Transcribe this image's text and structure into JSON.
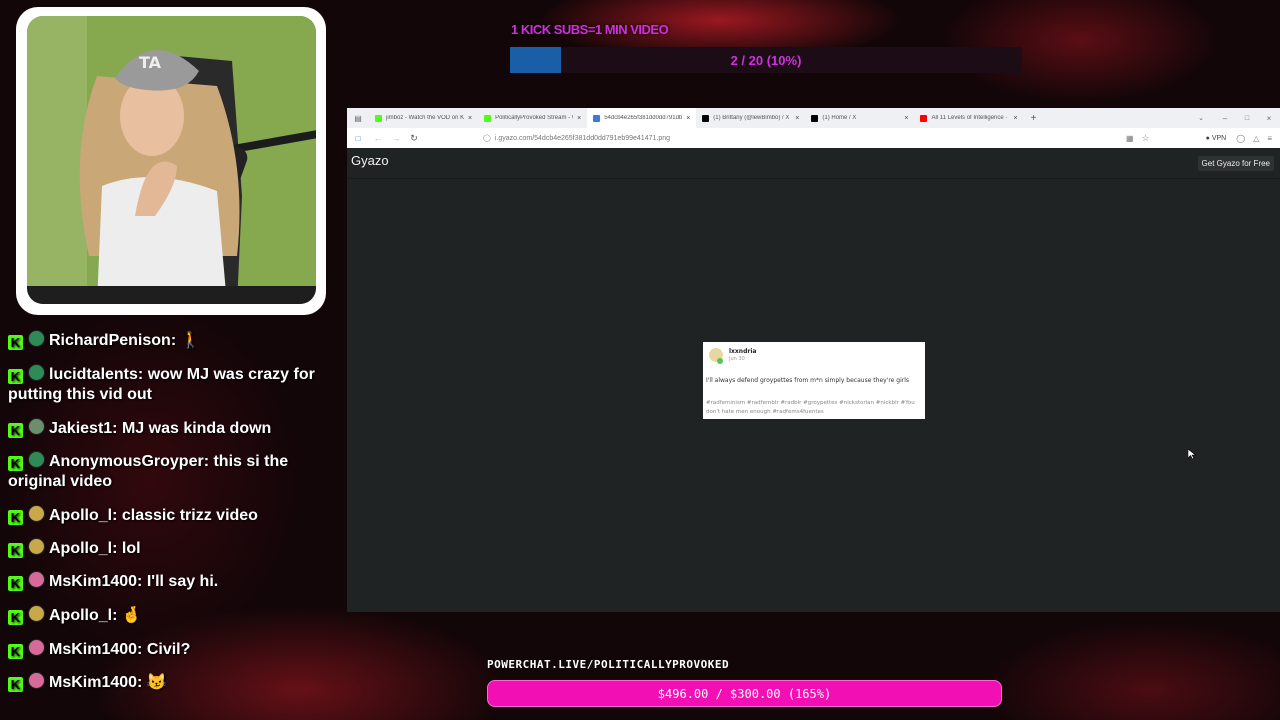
{
  "sub_goal": {
    "title": "1 KICK SUBS=1 MIN VIDEO",
    "count": "2 / 20 (10%)",
    "progress": 0.1
  },
  "browser": {
    "tabs": [
      {
        "title": "jimboz - Watch the VOD on Kic",
        "icon": "kick-icon",
        "color": "#53fc18",
        "active": false
      },
      {
        "title": "PoliticallyProvoked Stream - W",
        "icon": "kick-icon",
        "color": "#53fc18",
        "active": false
      },
      {
        "title": "54dcb4e265f381dd0dd791db9",
        "icon": "gyazo-icon",
        "color": "#3a7bd5",
        "active": true
      },
      {
        "title": "(1) Brittany (@lewBimbo) / X",
        "icon": "x-icon",
        "color": "#000000",
        "active": false
      },
      {
        "title": "(1) Home / X",
        "icon": "x-icon",
        "color": "#000000",
        "active": false
      },
      {
        "title": "All 11 Levels of Intelligence · W",
        "icon": "youtube-icon",
        "color": "#ff0000",
        "active": false
      }
    ],
    "url": "i.gyazo.com/54dcb4e265f381dd0dd791eb99e41471.png",
    "vpn_label": "VPN"
  },
  "gyazo": {
    "logo": "Gyazo",
    "cta": "Get Gyazo for Free"
  },
  "post": {
    "username": "lxxndria",
    "date": "Jun 30",
    "text": "I'll always defend groypettes from m*n simply because they're girls",
    "tags": "#radfeminism  #radfemblr  #radblr  #groypettes  #nickstorian  #nickblr  #You don't hate men enough  #radfems4fuentes"
  },
  "chat": [
    {
      "user": "RichardPenison",
      "text": "🚶",
      "badge_color": "#2e8b57"
    },
    {
      "user": "lucidtalents",
      "text": "wow MJ was crazy for putting this vid out",
      "badge_color": "#2e8b57"
    },
    {
      "user": "Jakiest1",
      "text": "MJ was kinda down",
      "badge_color": "#6b8e6b"
    },
    {
      "user": "AnonymousGroyper",
      "text": "this si the original video",
      "badge_color": "#2e8b57"
    },
    {
      "user": "Apollo_l",
      "text": "classic trizz video",
      "badge_color": "#c8a84a"
    },
    {
      "user": "Apollo_l",
      "text": "lol",
      "badge_color": "#c8a84a"
    },
    {
      "user": "MsKim1400",
      "text": "I'll say hi.",
      "badge_color": "#d86a9a"
    },
    {
      "user": "Apollo_l",
      "text": "🤞",
      "badge_color": "#c8a84a"
    },
    {
      "user": "MsKim1400",
      "text": "Civil?",
      "badge_color": "#d86a9a"
    },
    {
      "user": "MsKim1400",
      "text": "😼",
      "badge_color": "#d86a9a"
    }
  ],
  "powerchat": {
    "label": "POWERCHAT.LIVE/POLITICALLYPROVOKED",
    "amount": "$496.00 / $300.00 (165%)",
    "progress": 1.65
  }
}
